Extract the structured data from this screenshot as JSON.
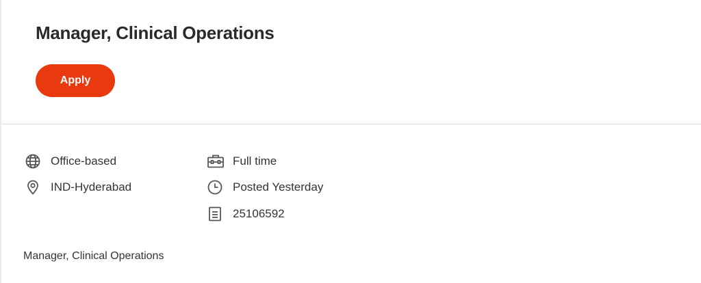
{
  "job": {
    "title": "Manager, Clinical Operations",
    "apply_label": "Apply",
    "accent_color": "#e83a0e"
  },
  "details": {
    "left": [
      {
        "icon": "globe-icon",
        "text": "Office-based"
      },
      {
        "icon": "location-pin-icon",
        "text": "IND-Hyderabad"
      }
    ],
    "right": [
      {
        "icon": "briefcase-icon",
        "text": "Full time"
      },
      {
        "icon": "clock-icon",
        "text": "Posted Yesterday"
      },
      {
        "icon": "document-icon",
        "text": "25106592"
      }
    ]
  },
  "description": {
    "text": "Manager, Clinical Operations"
  }
}
